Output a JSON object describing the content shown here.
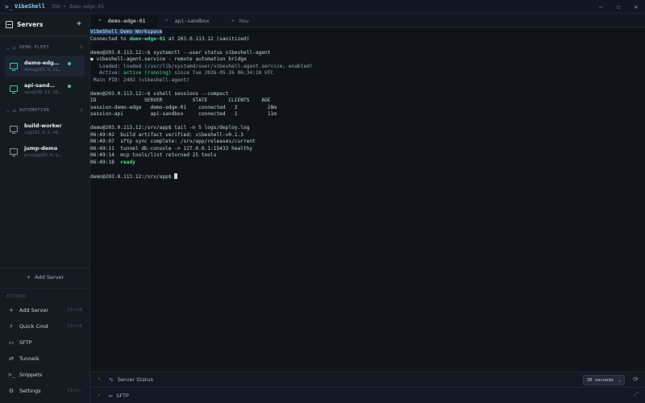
{
  "titlebar": {
    "app_name": "VibeShell",
    "subtitle": "SSH • demo-edge-01"
  },
  "sidebar": {
    "title": "Servers",
    "groups": [
      {
        "name": "DEMO FLEET",
        "count": "2",
        "servers": [
          {
            "name": "demo-edg…",
            "host": "demo@203.0.11…"
          },
          {
            "name": "api-sand…",
            "host": "ops@198.51.10…"
          }
        ]
      },
      {
        "name": "AUTOMATION",
        "count": "2",
        "servers": [
          {
            "name": "build-worker",
            "host": "ci@192.0.2.44…"
          },
          {
            "name": "jump-demo",
            "host": "proxy@203.0.1…"
          }
        ]
      }
    ],
    "add_server_label": "Add Server",
    "actions_label": "ACTIONS",
    "actions": [
      {
        "label": "Add Server",
        "shortcut": "Ctrl+N"
      },
      {
        "label": "Quick Cmd",
        "shortcut": "Ctrl+K"
      },
      {
        "label": "SFTP",
        "shortcut": ""
      },
      {
        "label": "Tunnels",
        "shortcut": ""
      },
      {
        "label": "Snippets",
        "shortcut": ""
      },
      {
        "label": "Settings",
        "shortcut": "Ctrl+,"
      }
    ]
  },
  "tabs": [
    {
      "label": "demo-edge-01"
    },
    {
      "label": "api-sandbox"
    },
    {
      "label": "New"
    }
  ],
  "terminal": {
    "banner": "VibeShell Demo Workspace",
    "connected_prefix": "Connected to ",
    "connected_host": "demo-edge-01",
    "connected_suffix": " at 203.0.113.12 (sanitized)",
    "cmd1": "demo@203.0.113.12:~$ systemctl --user status vibeshell-agent",
    "svc_name": "● vibeshell-agent.service - remote automation bridge",
    "svc_loaded": "   Loaded: loaded (/usr/lib/systemd/user/vibeshell-agent.service; enabled)",
    "svc_active_prefix": "   Active: ",
    "svc_active_state": "active (running)",
    "svc_active_suffix": " since Tue 2026-05-26 06:34:18 UTC",
    "svc_pid": " Main PID: 2402 (vibeshell-agent)",
    "cmd2": "demo@203.0.113.12:~$ vshell sessions --compact",
    "sessions_header": "ID                SERVER          STATE       CLIENTS    AGE",
    "session_rows": [
      "session-demo-edge   demo-edge-01    connected   2          28m",
      "session-api         api-sandbox     connected   1          11m"
    ],
    "cmd3": "demo@203.0.113.12:/srv/app$ tail -n 5 logs/deploy.log",
    "log_lines": [
      "06:49:02  build artifact verified: vibeshell-v0.1.3",
      "06:49:07  sftp sync complete: /srv/app/releases/current",
      "06:49:11  tunnel db-console -> 127.0.0.1:15432 healthy",
      "06:49:14  mcp tools/list returned 25 tools"
    ],
    "log_ready_time": "06:49:18  ",
    "log_ready_word": "ready",
    "prompt": "demo@203.0.113.12:/srv/app$ "
  },
  "panels": {
    "server_status": "Server Status",
    "refresh_interval": "30 seconds",
    "sftp": "SFTP"
  },
  "colors": {
    "accent_green": "#4ade80",
    "accent_blue": "#6aa8ff",
    "background": "#0f141b"
  }
}
